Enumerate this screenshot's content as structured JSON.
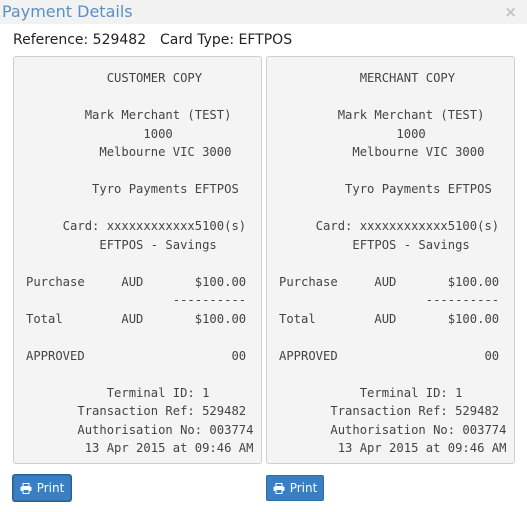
{
  "window": {
    "title": "Payment Details",
    "close_icon": "×"
  },
  "reference": "Reference: 529482",
  "card_type": "Card Type: EFTPOS",
  "receipts": [
    {
      "copy": "CUSTOMER COPY",
      "text": "           CUSTOMER COPY\n\n        Mark Merchant (TEST)\n                1000\n          Melbourne VIC 3000\n\n         Tyro Payments EFTPOS\n\n     Card: xxxxxxxxxxxx5100(s)\n          EFTPOS - Savings\n\nPurchase     AUD       $100.00\n                    ----------\nTotal        AUD       $100.00\n\nAPPROVED                    00\n\n           Terminal ID: 1\n       Transaction Ref: 529482\n       Authorisation No: 003774\n        13 Apr 2015 at 09:46 AM"
    },
    {
      "copy": "MERCHANT COPY",
      "text": "           MERCHANT COPY\n\n        Mark Merchant (TEST)\n                1000\n          Melbourne VIC 3000\n\n         Tyro Payments EFTPOS\n\n     Card: xxxxxxxxxxxx5100(s)\n          EFTPOS - Savings\n\nPurchase     AUD       $100.00\n                    ----------\nTotal        AUD       $100.00\n\nAPPROVED                    00\n\n           Terminal ID: 1\n       Transaction Ref: 529482\n       Authorisation No: 003774\n        13 Apr 2015 at 09:46 AM"
    }
  ],
  "buttons": {
    "print_label": "Print",
    "print_icon": "printer-icon"
  },
  "colors": {
    "title": "#5a8fc4",
    "button": "#3a7fc1",
    "receipt_bg": "#f4f4f4"
  }
}
